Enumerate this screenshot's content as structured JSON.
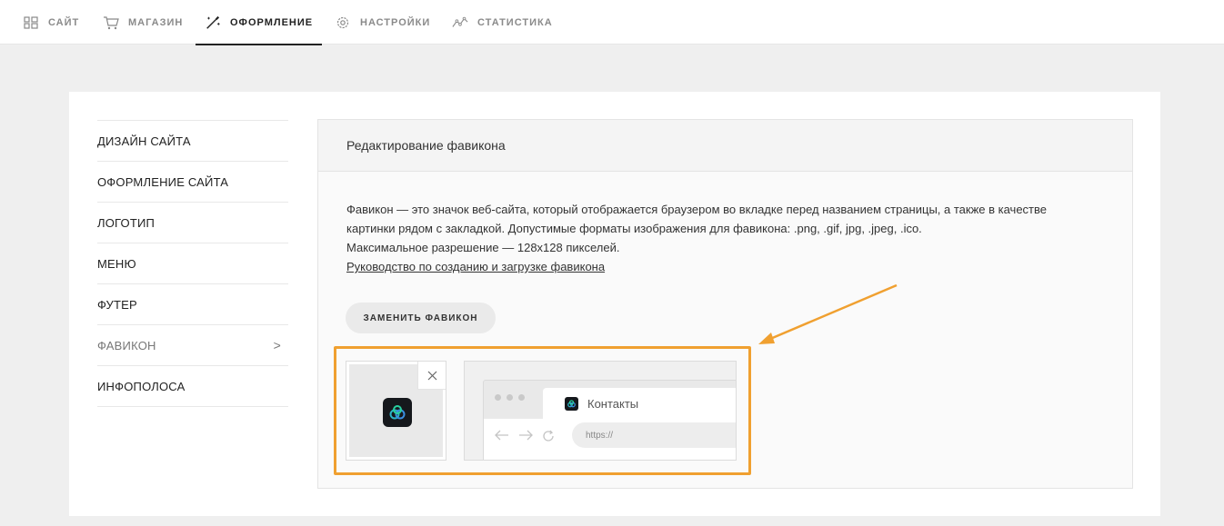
{
  "topnav": {
    "items": [
      {
        "label": "САЙТ",
        "icon": "grid-icon"
      },
      {
        "label": "МАГАЗИН",
        "icon": "cart-icon"
      },
      {
        "label": "ОФОРМЛЕНИЕ",
        "icon": "magic-wand-icon",
        "active": true
      },
      {
        "label": "НАСТРОЙКИ",
        "icon": "gear-icon"
      },
      {
        "label": "СТАТИСТИКА",
        "icon": "chart-line-icon"
      }
    ]
  },
  "sidebar": {
    "items": [
      {
        "label": "ДИЗАЙН САЙТА"
      },
      {
        "label": "ОФОРМЛЕНИЕ САЙТА"
      },
      {
        "label": "ЛОГОТИП"
      },
      {
        "label": "МЕНЮ"
      },
      {
        "label": "ФУТЕР"
      },
      {
        "label": "ФАВИКОН",
        "active": true,
        "chevron": ">"
      },
      {
        "label": "ИНФОПОЛОСА"
      }
    ]
  },
  "panel": {
    "title": "Редактирование фавикона",
    "description_line1": "Фавикон — это значок веб-сайта, который отображается браузером во вкладке перед названием страницы, а также в качестве",
    "description_line2": "картинки рядом с закладкой. Допустимые форматы изображения для фавикона: .png, .gif, jpg, .jpeg, .ico.",
    "description_line3": "Максимальное разрешение — 128x128 пикселей.",
    "guide_link": "Руководство по созданию и загрузке фавикона",
    "replace_button": "ЗАМЕНИТЬ ФАВИКОН"
  },
  "preview": {
    "tab_title": "Контакты",
    "url": "https://"
  },
  "colors": {
    "highlight": "#f0a030",
    "background": "#efefef"
  }
}
